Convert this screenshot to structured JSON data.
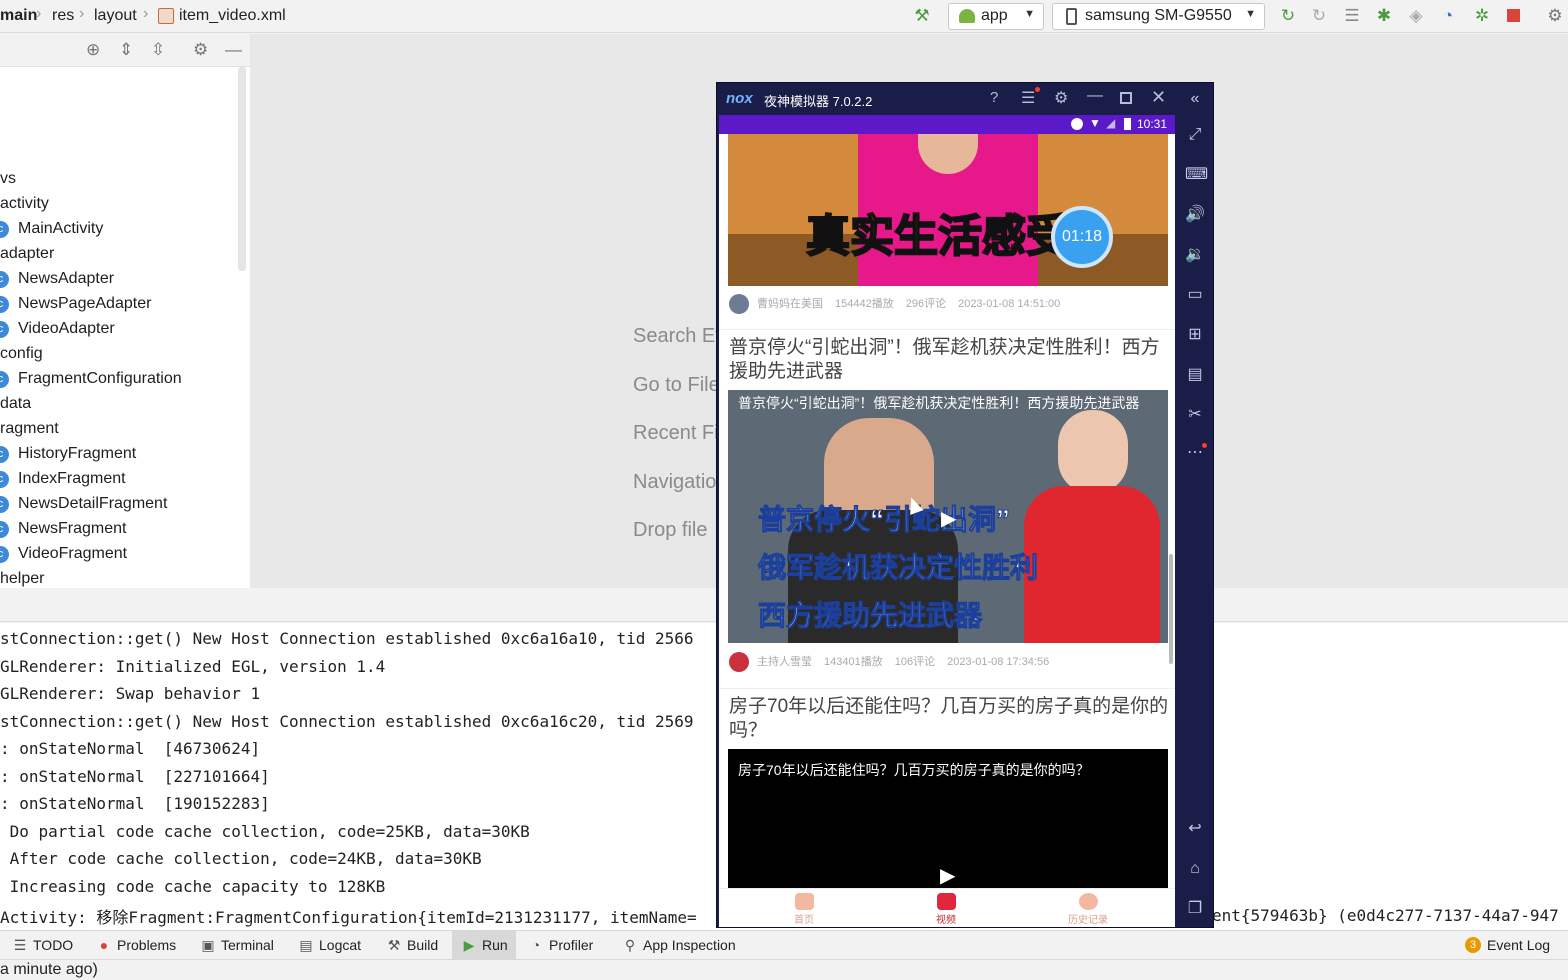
{
  "breadcrumb": {
    "items": [
      "main",
      "res",
      "layout",
      "item_video.xml"
    ]
  },
  "toolbar": {
    "run_config": "app",
    "device": "samsung SM-G9550"
  },
  "project_tree": {
    "rows": [
      {
        "label": "vs",
        "class_badge": false
      },
      {
        "label": "activity",
        "class_badge": false
      },
      {
        "label": "MainActivity",
        "class_badge": true
      },
      {
        "label": "adapter",
        "class_badge": false
      },
      {
        "label": "NewsAdapter",
        "class_badge": true
      },
      {
        "label": "NewsPageAdapter",
        "class_badge": true
      },
      {
        "label": "VideoAdapter",
        "class_badge": true
      },
      {
        "label": "config",
        "class_badge": false
      },
      {
        "label": "FragmentConfiguration",
        "class_badge": true
      },
      {
        "label": "data",
        "class_badge": false
      },
      {
        "label": "ragment",
        "class_badge": false
      },
      {
        "label": "HistoryFragment",
        "class_badge": true
      },
      {
        "label": "IndexFragment",
        "class_badge": true
      },
      {
        "label": "NewsDetailFragment",
        "class_badge": true
      },
      {
        "label": "NewsFragment",
        "class_badge": true
      },
      {
        "label": "VideoFragment",
        "class_badge": true
      },
      {
        "label": "helper",
        "class_badge": false
      }
    ]
  },
  "editor_hints": [
    "Search Ev",
    "Go to File",
    "Recent Fi",
    "Navigatio",
    "Drop file"
  ],
  "console": {
    "lines": [
      "stConnection::get() New Host Connection established 0xc6a16a10, tid 2566",
      "GLRenderer: Initialized EGL, version 1.4",
      "GLRenderer: Swap behavior 1",
      "stConnection::get() New Host Connection established 0xc6a16c20, tid 2569",
      ": onStateNormal  [46730624]",
      ": onStateNormal  [227101664]",
      ": onStateNormal  [190152283]",
      " Do partial code cache collection, code=25KB, data=30KB",
      " After code cache collection, code=24KB, data=30KB",
      " Increasing code cache capacity to 128KB",
      "Activity: 移除Fragment:FragmentConfiguration{itemId=2131231177, itemName="
    ],
    "last_line_tail": "ent{579463b} (e0d4c277-7137-44a7-947"
  },
  "tool_windows": [
    "TODO",
    "Problems",
    "Terminal",
    "Logcat",
    "Build",
    "Run",
    "Profiler",
    "App Inspection"
  ],
  "event_log": {
    "label": "Event Log",
    "count": "3"
  },
  "status_text": "a minute ago)",
  "emulator": {
    "title": "夜神模拟器 7.0.2.2",
    "logo": "nox",
    "clock": "10:31",
    "video_timer": "01:18",
    "items": [
      {
        "author": "曹妈妈在美国",
        "plays": "154442播放",
        "comments": "296评论",
        "time": "2023-01-08 14:51:00",
        "thumb_text": "真实生活感受"
      },
      {
        "title": "普京停火“引蛇出洞”！俄军趁机获决定性胜利！西方援助先进武器",
        "overlay": "普京停火“引蛇出洞”！俄军趁机获决定性胜利！西方援助先进武器",
        "banner_lines": [
          "普京停火“引蛇出洞”",
          "俄军趁机获决定性胜利",
          "西方援助先进武器"
        ],
        "author": "主持人雪莹",
        "plays": "143401播放",
        "comments": "106评论",
        "time": "2023-01-08 17:34:56"
      },
      {
        "title": "房子70年以后还能住吗？几百万买的房子真的是你的吗？",
        "overlay": "房子70年以后还能住吗？几百万买的房子真的是你的吗？"
      }
    ],
    "tabs": [
      "首页",
      "视频",
      "历史记录"
    ]
  }
}
